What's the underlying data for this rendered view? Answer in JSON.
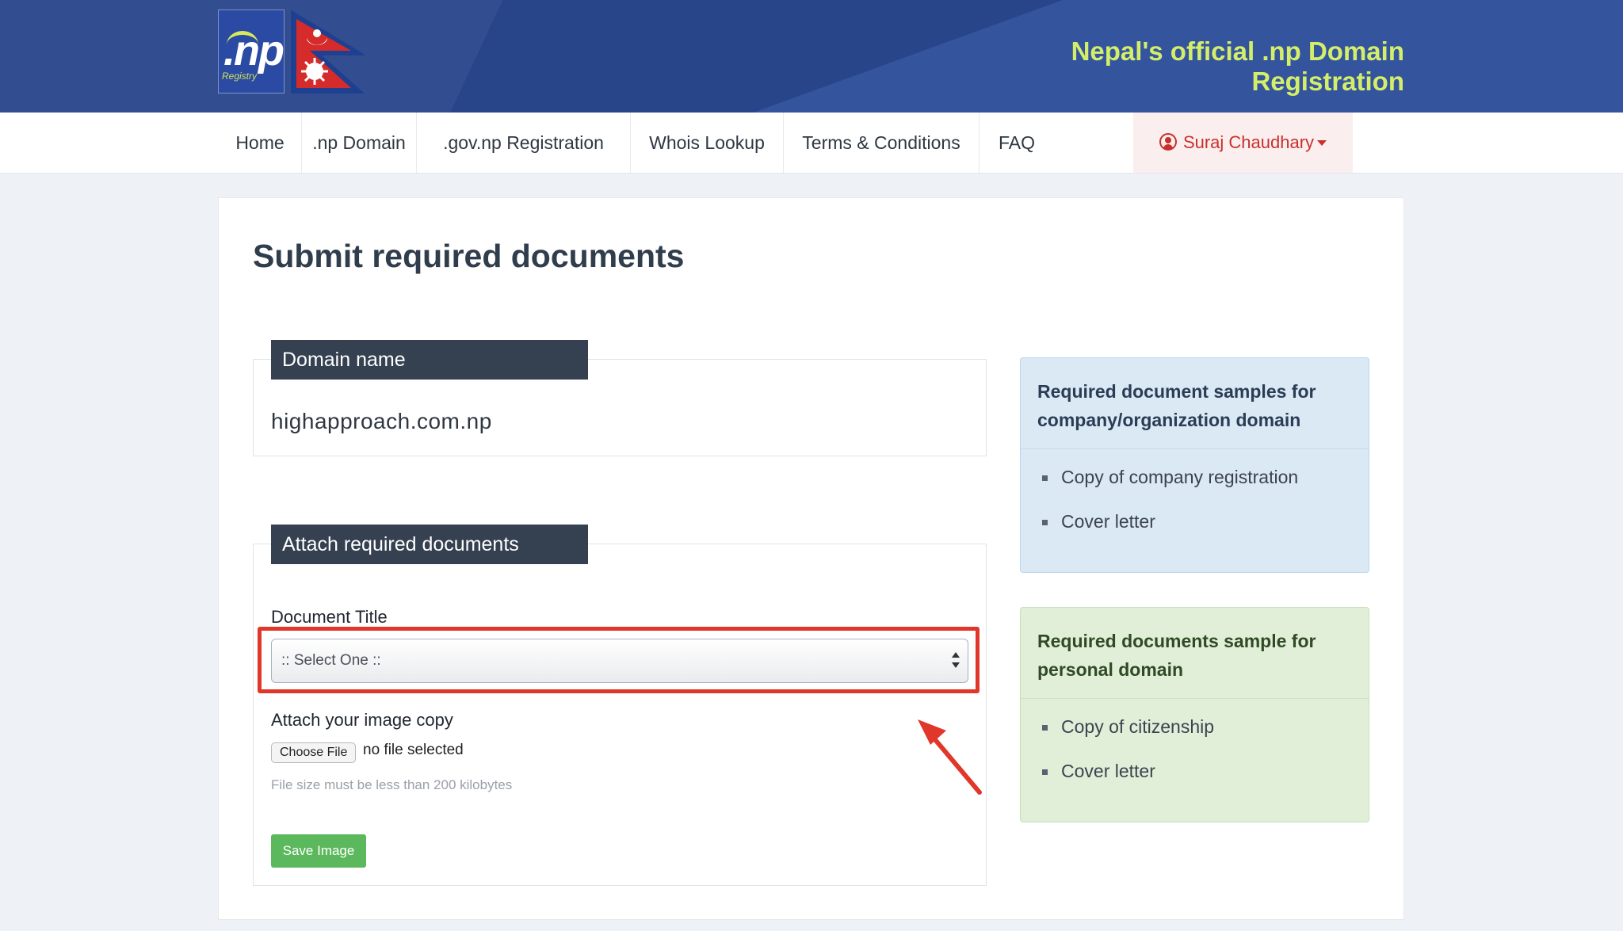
{
  "header": {
    "logo_text": ".np",
    "logo_sub": "Registry",
    "site_title": "Nepal's official .np Domain Registration"
  },
  "nav": {
    "items": [
      {
        "label": "Home"
      },
      {
        "label": ".np Domain"
      },
      {
        "label": ".gov.np Registration"
      },
      {
        "label": "Whois Lookup"
      },
      {
        "label": "Terms & Conditions"
      },
      {
        "label": "FAQ"
      }
    ],
    "user_name": "Suraj Chaudhary"
  },
  "page": {
    "title": "Submit required documents"
  },
  "domain_section": {
    "legend": "Domain name",
    "value": "highapproach.com.np"
  },
  "attach_section": {
    "legend": "Attach required documents",
    "document_title_label": "Document Title",
    "select_value": ":: Select One ::",
    "image_label": "Attach your image copy",
    "choose_file_label": "Choose File",
    "no_file_text": "no file selected",
    "help_text": "File size must be less than 200 kilobytes",
    "save_label": "Save Image"
  },
  "panels": {
    "company": {
      "title": "Required document samples for company/organization domain",
      "items": [
        "Copy of company registration",
        "Cover letter"
      ]
    },
    "personal": {
      "title": "Required documents sample for personal domain",
      "items": [
        "Copy of citizenship",
        "Cover letter"
      ]
    }
  },
  "colors": {
    "banner": "#2c4d9a",
    "title_accent": "#d4ee6a",
    "highlight": "#e0372a",
    "save_button": "#5cb85c",
    "user_menu": "#c9302c"
  }
}
